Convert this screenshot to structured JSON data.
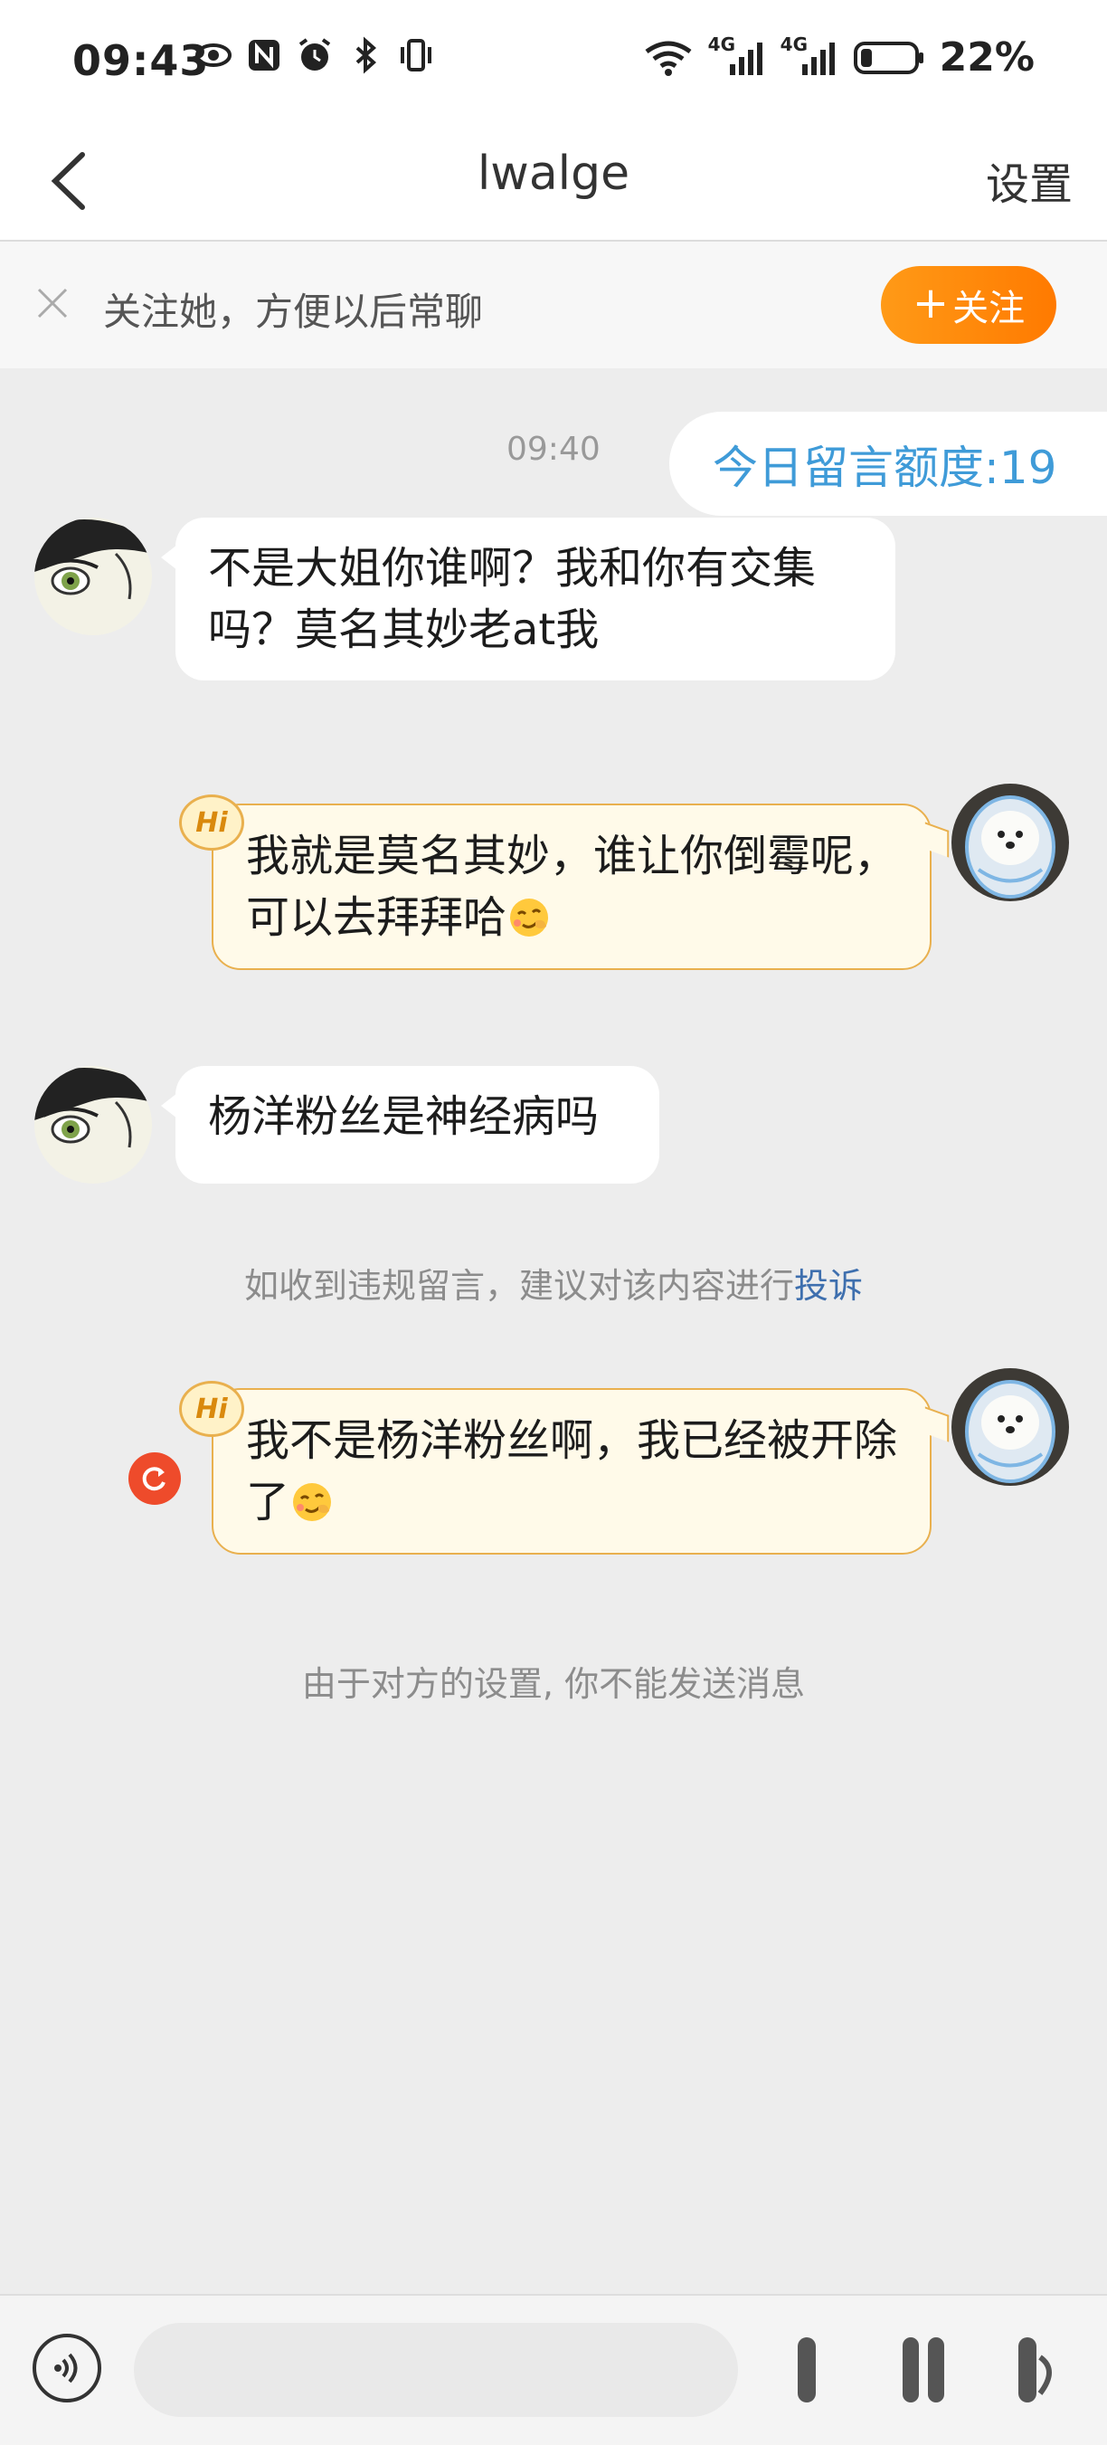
{
  "status_bar": {
    "time": "09:43",
    "network_1": "4G",
    "network_2": "4G",
    "battery": "22%",
    "battery_level": 0.22
  },
  "nav": {
    "title": "lwalge",
    "settings_label": "设置"
  },
  "follow_banner": {
    "text": "关注她，方便以后常聊",
    "button_label": "关注"
  },
  "chat": {
    "timestamp": "09:40",
    "quota": "今日留言额度:19",
    "messages": [
      {
        "from": "other",
        "text": "不是大姐你谁啊？我和你有交集吗？莫名其妙老at我"
      },
      {
        "from": "me",
        "text": "我就是莫名其妙，谁让你倒霉呢，可以去拜拜哈",
        "badge": "Hi"
      },
      {
        "from": "other",
        "text": "杨洋粉丝是神经病吗"
      },
      {
        "from": "me",
        "text": "我不是杨洋粉丝啊，我已经被开除了",
        "badge": "Hi"
      }
    ],
    "report_notice": "如收到违规留言，建议对该内容进行",
    "report_link": "投诉",
    "blocked_notice": "由于对方的设置, 你不能发送消息"
  },
  "colors": {
    "accent_orange": "#ff8a00",
    "link_blue": "#3e6fae",
    "quota_blue": "#3f9bd8",
    "bubble_out_bg": "#fffae9",
    "bubble_out_border": "#e9b04e",
    "resend_red": "#ee4b2b"
  }
}
